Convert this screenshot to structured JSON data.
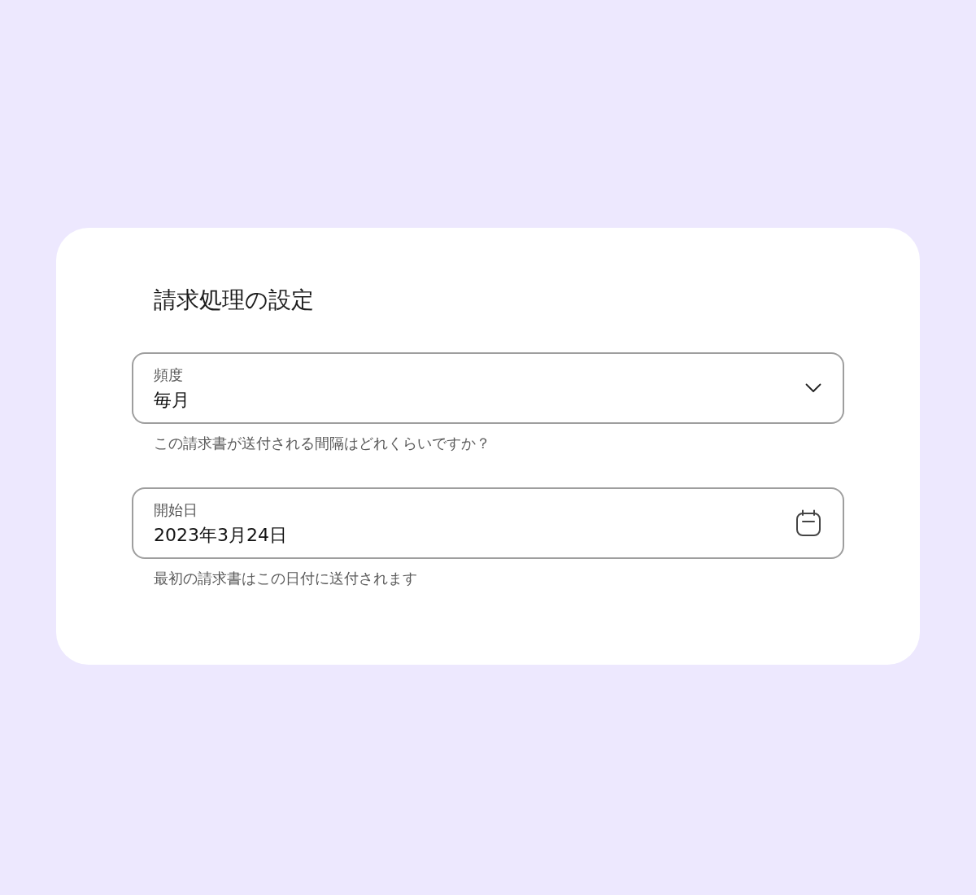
{
  "card": {
    "title": "請求処理の設定"
  },
  "fields": [
    {
      "kind": "select",
      "label": "頻度",
      "value": "毎月",
      "helper": "この請求書が送付される間隔はどれくらいですか？"
    },
    {
      "kind": "date",
      "label": "開始日",
      "value": "2023年3月24日",
      "helper": "最初の請求書はこの日付に送付されます"
    }
  ]
}
